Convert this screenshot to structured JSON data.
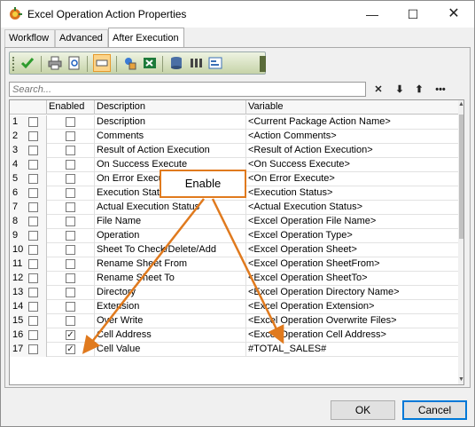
{
  "window": {
    "title": "Excel Operation Action Properties"
  },
  "tabs": [
    {
      "label": "Workflow"
    },
    {
      "label": "Advanced"
    },
    {
      "label": "After Execution"
    }
  ],
  "toolbar": {
    "icons": [
      "checkmark-icon",
      "print-icon",
      "print-preview-icon",
      "field-chooser-icon",
      "variable-icon",
      "excel-icon",
      "database-icon",
      "columns-icon",
      "form-icon",
      "toolbar-options-icon"
    ]
  },
  "search": {
    "placeholder": "Search..."
  },
  "grid": {
    "columns": {
      "enabled": "Enabled",
      "description": "Description",
      "variable": "Variable"
    },
    "rows": [
      {
        "num": "1",
        "enabled": false,
        "description": "Description",
        "variable": "<Current Package Action Name>"
      },
      {
        "num": "2",
        "enabled": false,
        "description": "Comments",
        "variable": "<Action Comments>"
      },
      {
        "num": "3",
        "enabled": false,
        "description": "Result of Action Execution",
        "variable": "<Result of Action Execution>"
      },
      {
        "num": "4",
        "enabled": false,
        "description": "On Success Execute",
        "variable": "<On Success Execute>"
      },
      {
        "num": "5",
        "enabled": false,
        "description": "On Error Execute",
        "variable": "<On Error Execute>"
      },
      {
        "num": "6",
        "enabled": false,
        "description": "Execution Status",
        "variable": "<Execution Status>"
      },
      {
        "num": "7",
        "enabled": false,
        "description": "Actual Execution Status",
        "variable": "<Actual Execution Status>"
      },
      {
        "num": "8",
        "enabled": false,
        "description": "File Name",
        "variable": "<Excel Operation File Name>"
      },
      {
        "num": "9",
        "enabled": false,
        "description": "Operation",
        "variable": "<Excel Operation Type>"
      },
      {
        "num": "10",
        "enabled": false,
        "description": "Sheet To Check/Delete/Add",
        "variable": "<Excel Operation Sheet>"
      },
      {
        "num": "11",
        "enabled": false,
        "description": "Rename Sheet From",
        "variable": "<Excel Operation SheetFrom>"
      },
      {
        "num": "12",
        "enabled": false,
        "description": "Rename Sheet To",
        "variable": "<Excel Operation SheetTo>"
      },
      {
        "num": "13",
        "enabled": false,
        "description": "Directory",
        "variable": "<Excel Operation Directory Name>"
      },
      {
        "num": "14",
        "enabled": false,
        "description": "Extension",
        "variable": "<Excel Operation Extension>"
      },
      {
        "num": "15",
        "enabled": false,
        "description": "Over Write",
        "variable": "<Excel Operation Overwrite Files>"
      },
      {
        "num": "16",
        "enabled": true,
        "description": "Cell Address",
        "variable": "<Excel Operation Cell Address>"
      },
      {
        "num": "17",
        "enabled": true,
        "description": "Cell Value",
        "variable": "#TOTAL_SALES#"
      }
    ]
  },
  "buttons": {
    "ok": "OK",
    "cancel": "Cancel"
  },
  "callout": {
    "label": "Enable"
  },
  "colors": {
    "callout_border": "#e07a1e",
    "toolbar_bg": "#c6d3a8",
    "cancel_focus": "#0078d7"
  }
}
